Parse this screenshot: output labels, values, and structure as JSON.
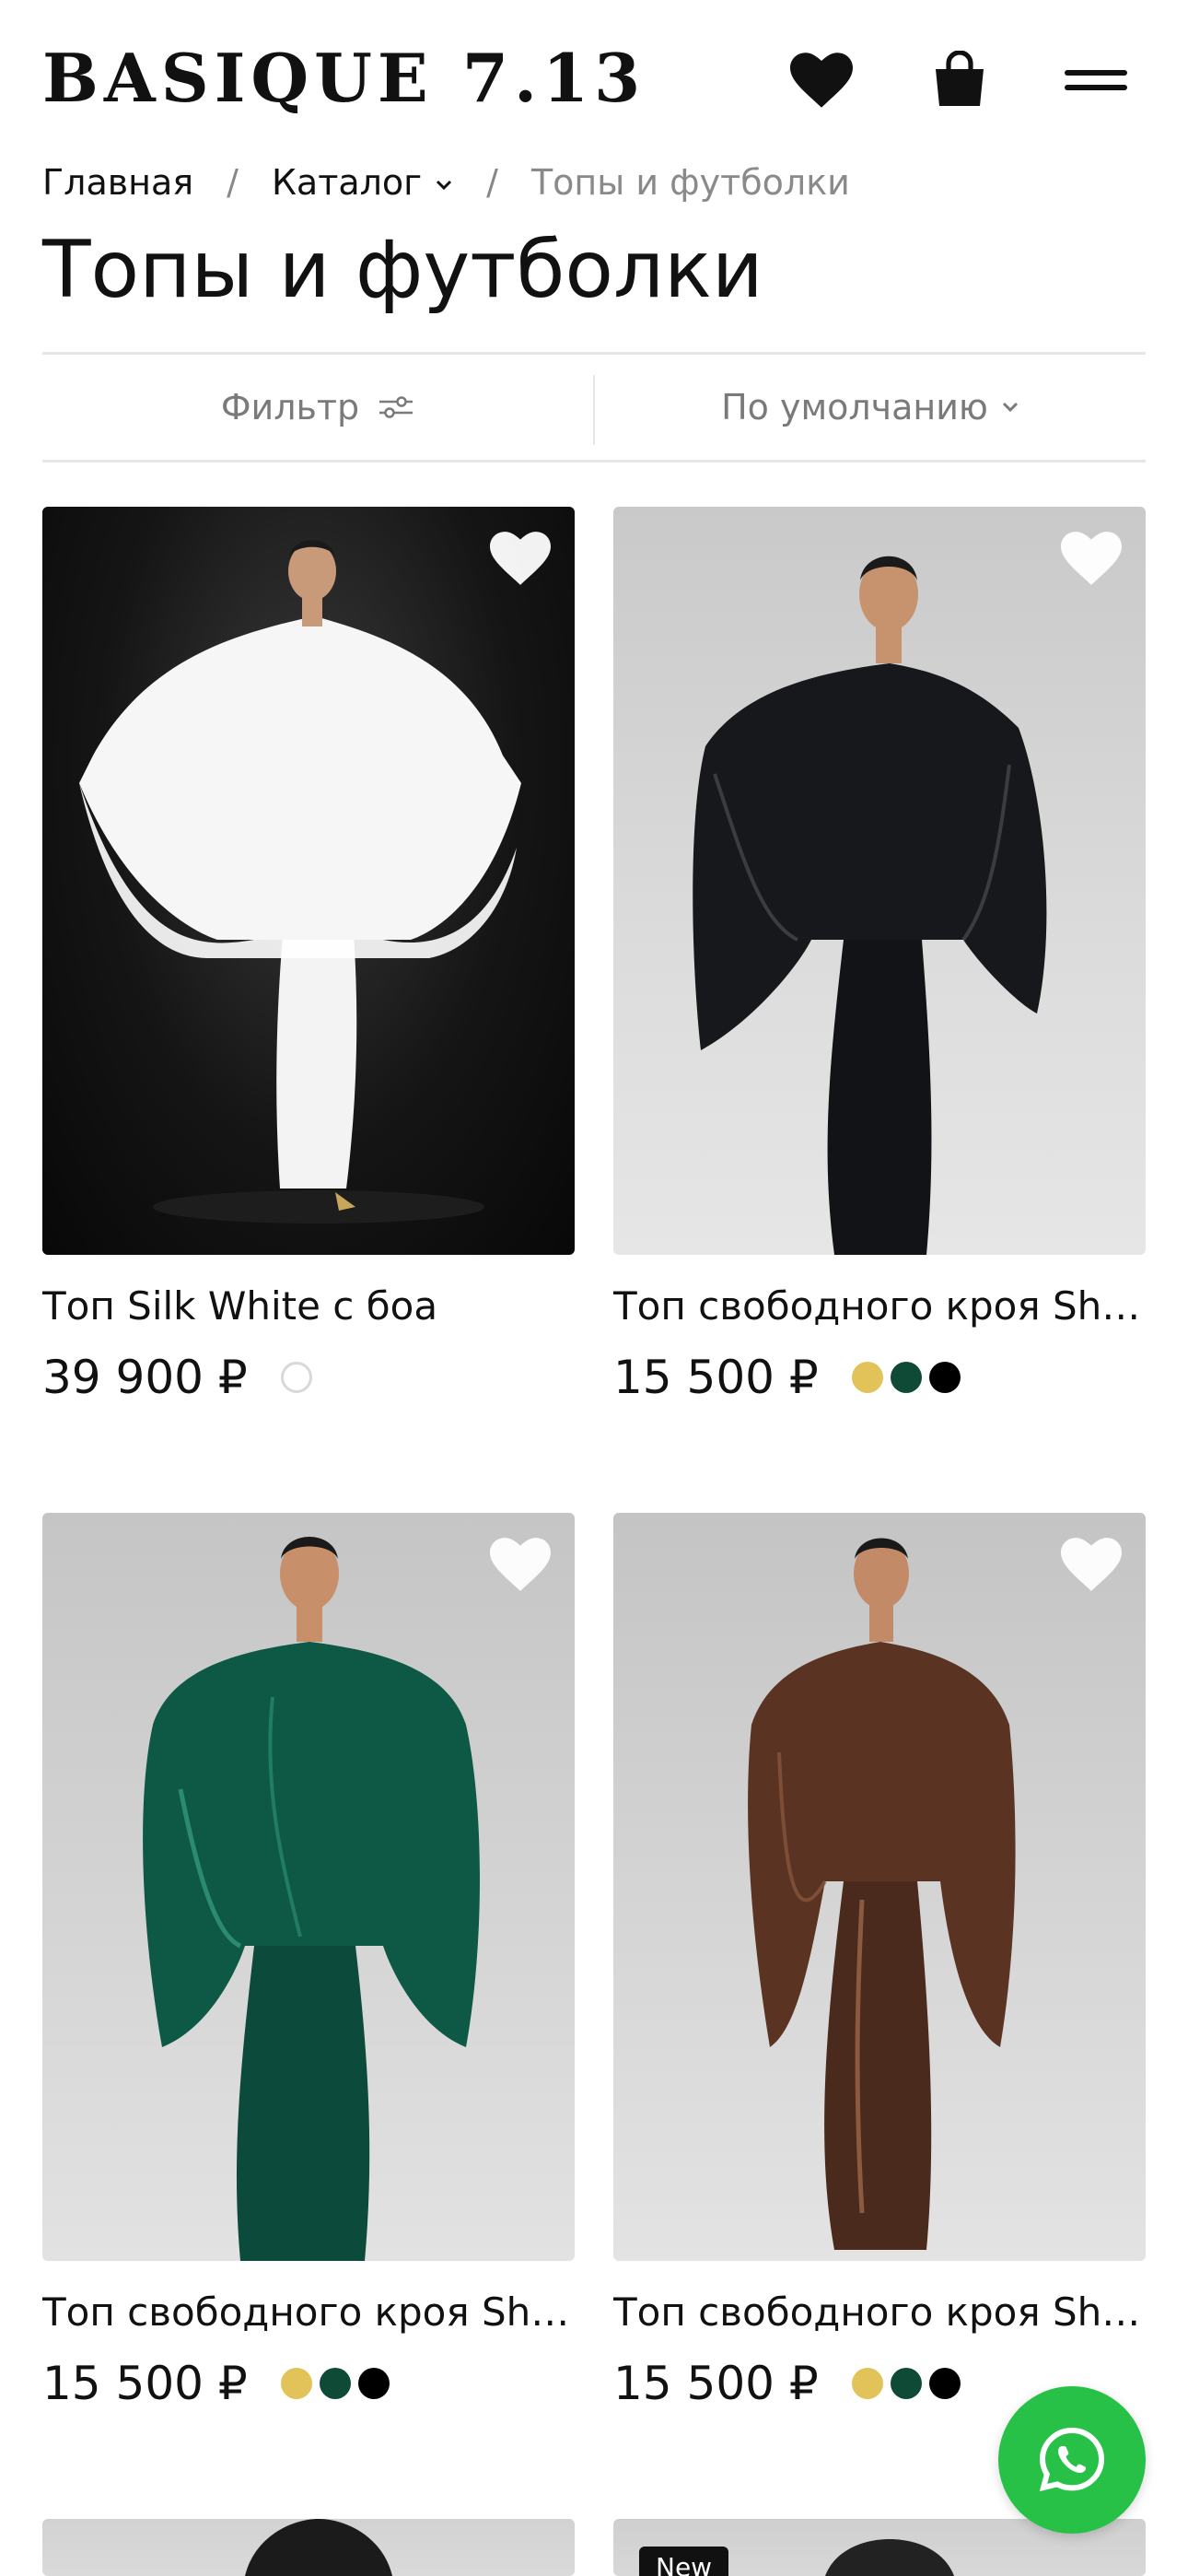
{
  "header": {
    "logo_text": "BASIQUE 7.13",
    "icons": {
      "favorites": "heart-icon",
      "cart": "bag-icon",
      "menu": "hamburger-icon"
    }
  },
  "breadcrumb": {
    "home": "Главная",
    "catalog": "Каталог",
    "current": "Топы и футболки"
  },
  "page": {
    "title": "Топы и футболки"
  },
  "filterbar": {
    "filter_label": "Фильтр",
    "sort_label": "По умолчанию"
  },
  "products": [
    {
      "name": "Топ Silk White с боа",
      "price": "39 900 ₽",
      "colors": [
        "#ffffff"
      ]
    },
    {
      "name": "Топ свободного кроя Shi...",
      "price": "15 500 ₽",
      "colors": [
        "#e2c35a",
        "#0f4a36",
        "#000000"
      ]
    },
    {
      "name": "Топ свободного кроя Shi...",
      "price": "15 500 ₽",
      "colors": [
        "#e2c35a",
        "#0f4a36",
        "#000000"
      ]
    },
    {
      "name": "Топ свободного кроя Shi...",
      "price": "15 500 ₽",
      "colors": [
        "#e2c35a",
        "#0f4a36",
        "#000000"
      ]
    },
    {
      "badge": "New"
    }
  ],
  "colors": {
    "whatsapp": "#27c148",
    "text": "#111111",
    "muted": "#8a8a8a"
  }
}
